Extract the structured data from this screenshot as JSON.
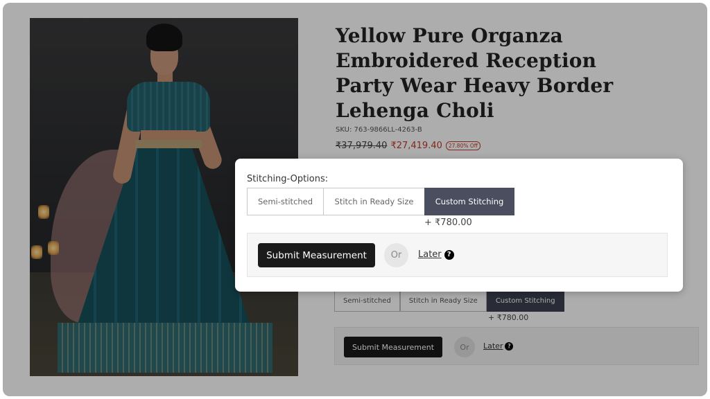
{
  "product": {
    "title": "Yellow Pure Organza Embroidered Reception Party Wear Heavy Border Lehenga Choli",
    "sku": "SKU: 763-9866LL-4263-B",
    "mrp": "₹37,979.40",
    "price": "₹27,419.40",
    "discount_badge": "27.80% Off"
  },
  "stitching": {
    "label": "Stitching-Options:",
    "options": [
      "Semi-stitched",
      "Stitch in Ready Size",
      "Custom Stitching"
    ],
    "selected": "Custom Stitching",
    "extra_price": "+ ₹780.00",
    "submit_label": "Submit Measurement",
    "or_label": "Or",
    "later_label": "Later",
    "help_glyph": "?"
  },
  "colors": {
    "selected_option_bg": "#4a4e5e",
    "submit_bg": "#1b1b1b",
    "price_red": "#c0392b"
  }
}
